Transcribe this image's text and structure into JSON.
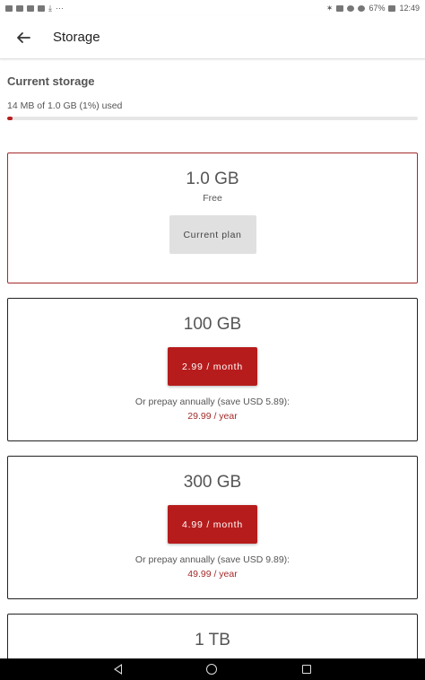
{
  "status_bar": {
    "battery": "67%",
    "time": "12:49",
    "overflow": "···"
  },
  "app_bar": {
    "title": "Storage",
    "back_icon": "arrow-left-icon"
  },
  "current_storage": {
    "title": "Current storage",
    "usage_text": "14 MB of 1.0 GB (1%) used",
    "used_fraction": 0.014,
    "accent_color": "#b71c1c"
  },
  "plans": [
    {
      "size": "1.0 GB",
      "subtitle": "Free",
      "button": "Current plan",
      "current": true
    },
    {
      "size": "100 GB",
      "button": "2.99 / month",
      "prepay": "Or prepay annually (save USD 5.89):",
      "yearly": "29.99 / year"
    },
    {
      "size": "300 GB",
      "button": "4.99 / month",
      "prepay": "Or prepay annually (save USD 9.89):",
      "yearly": "49.99 / year"
    },
    {
      "size": "1 TB"
    }
  ]
}
